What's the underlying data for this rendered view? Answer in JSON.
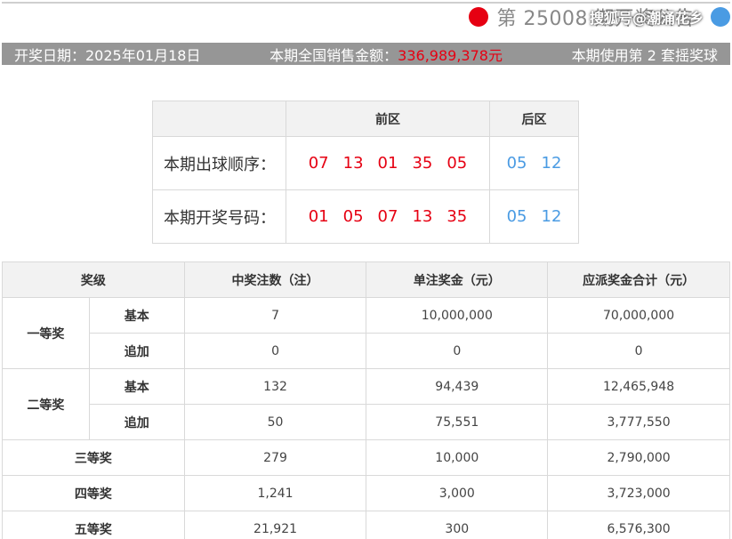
{
  "header": {
    "title": "第 25008 期开奖公告",
    "watermark": "搜狐号@潮涌花乡"
  },
  "info_bar": {
    "draw_date": "开奖日期：2025年01月18日",
    "sales_label": "本期全国销售金额：",
    "sales_amount": "336,989,378元",
    "ball_set": "本期使用第 2 套摇奖球"
  },
  "draw": {
    "headers": {
      "front": "前区",
      "back": "后区"
    },
    "rows": [
      {
        "label": "本期出球顺序：",
        "front": [
          "07",
          "13",
          "01",
          "35",
          "05"
        ],
        "back": [
          "05",
          "12"
        ]
      },
      {
        "label": "本期开奖号码：",
        "front": [
          "01",
          "05",
          "07",
          "13",
          "35"
        ],
        "back": [
          "05",
          "12"
        ]
      }
    ]
  },
  "prizes": {
    "headers": [
      "奖级",
      "中奖注数（注）",
      "单注奖金（元）",
      "应派奖金合计（元）"
    ],
    "first": {
      "name": "一等奖",
      "basic": {
        "type": "基本",
        "count": "7",
        "amount": "10,000,000",
        "total": "70,000,000"
      },
      "extra": {
        "type": "追加",
        "count": "0",
        "amount": "0",
        "total": "0"
      }
    },
    "second": {
      "name": "二等奖",
      "basic": {
        "type": "基本",
        "count": "132",
        "amount": "94,439",
        "total": "12,465,948"
      },
      "extra": {
        "type": "追加",
        "count": "50",
        "amount": "75,551",
        "total": "3,777,550"
      }
    },
    "third": {
      "name": "三等奖",
      "count": "279",
      "amount": "10,000",
      "total": "2,790,000"
    },
    "fourth": {
      "name": "四等奖",
      "count": "1,241",
      "amount": "3,000",
      "total": "3,723,000"
    },
    "fifth": {
      "name": "五等奖",
      "count": "21,921",
      "amount": "300",
      "total": "6,576,300"
    }
  }
}
